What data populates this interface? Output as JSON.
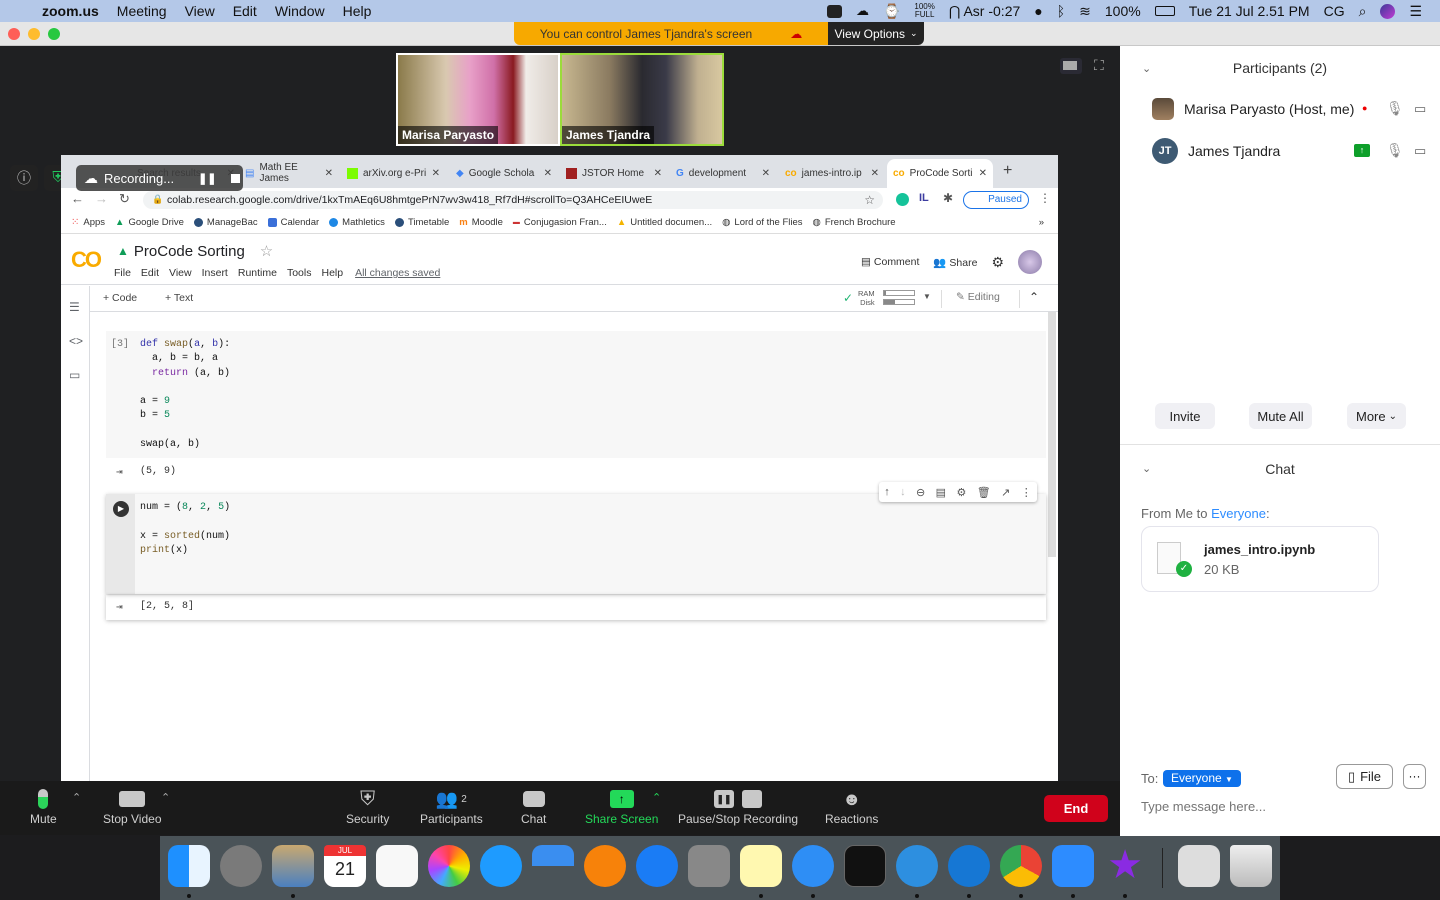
{
  "menubar": {
    "app": "zoom.us",
    "menus": [
      "Meeting",
      "View",
      "Edit",
      "Window",
      "Help"
    ],
    "battery_widget": "100%",
    "battery_widget_sub": "FULL",
    "prayer": "Asr -0:27",
    "battery": "100%",
    "datetime": "Tue 21 Jul  2.51 PM",
    "user": "CG"
  },
  "zoom": {
    "control_banner": "You can control James Tjandra's screen",
    "view_options": "View Options",
    "videos": [
      {
        "name": "Marisa Paryasto"
      },
      {
        "name": "James Tjandra"
      }
    ],
    "recording_label": "Recording...",
    "toolbar": {
      "mute": "Mute",
      "stop_video": "Stop Video",
      "security": "Security",
      "participants": "Participants",
      "participants_count": "2",
      "chat": "Chat",
      "share_screen": "Share Screen",
      "recording": "Pause/Stop Recording",
      "reactions": "Reactions",
      "end": "End"
    }
  },
  "browser": {
    "tabs": [
      {
        "title": "Search results",
        "active": false
      },
      {
        "title": "Math EE James",
        "active": false
      },
      {
        "title": "arXiv.org e-Pri",
        "active": false
      },
      {
        "title": "Google Schola",
        "active": false
      },
      {
        "title": "JSTOR Home",
        "active": false
      },
      {
        "title": "development",
        "active": false
      },
      {
        "title": "james-intro.ip",
        "active": false
      },
      {
        "title": "ProCode Sorti",
        "active": true
      }
    ],
    "url": "colab.research.google.com/drive/1kxTmAEq6U8hmtgePrN7wv3w418_Rf7dH#scrollTo=Q3AHCeEIUweE",
    "profile_status": "Paused",
    "bookmarks": [
      "Apps",
      "Google Drive",
      "ManageBac",
      "Calendar",
      "Mathletics",
      "Timetable",
      "Moodle",
      "Conjugasion Fran...",
      "Untitled documen...",
      "Lord of the Flies",
      "French Brochure"
    ],
    "more_bookmarks": "»"
  },
  "colab": {
    "logo": "CO",
    "title": "ProCode Sorting",
    "menu": [
      "File",
      "Edit",
      "View",
      "Insert",
      "Runtime",
      "Tools",
      "Help"
    ],
    "save_status": "All changes saved",
    "comment": "Comment",
    "share": "Share",
    "add_code": "+ Code",
    "add_text": "+ Text",
    "ram_label": "RAM",
    "disk_label": "Disk",
    "ram_usage": 0.05,
    "disk_usage": 0.35,
    "editing": "Editing",
    "cells": [
      {
        "exec_count": "[3]",
        "lines": [
          "def swap(a, b):",
          "  a, b = b, a",
          "  return (a, b)",
          "",
          "a = 9",
          "b = 5",
          "",
          "swap(a, b)"
        ],
        "output": "(5, 9)"
      },
      {
        "exec_count": "",
        "lines": [
          "num = (8, 2, 5)",
          "",
          "x = sorted(num)",
          "print(x)"
        ],
        "output": "[2, 5, 8]"
      }
    ]
  },
  "panel": {
    "participants_title": "Participants (2)",
    "participants": [
      {
        "name": "Marisa Paryasto (Host, me)",
        "initials": ""
      },
      {
        "name": "James Tjandra",
        "initials": "JT"
      }
    ],
    "invite": "Invite",
    "mute_all": "Mute All",
    "more": "More",
    "chat_title": "Chat",
    "chat_from": "From Me to ",
    "chat_to_name": "Everyone",
    "chat_colon": ":",
    "file_name": "james_intro.ipynb",
    "file_size": "20 KB",
    "to_label": "To:",
    "to_value": "Everyone",
    "file_button": "File",
    "more_button": "···",
    "message_placeholder": "Type message here..."
  },
  "dock": {
    "calendar_month": "JUL",
    "calendar_day": "21"
  }
}
